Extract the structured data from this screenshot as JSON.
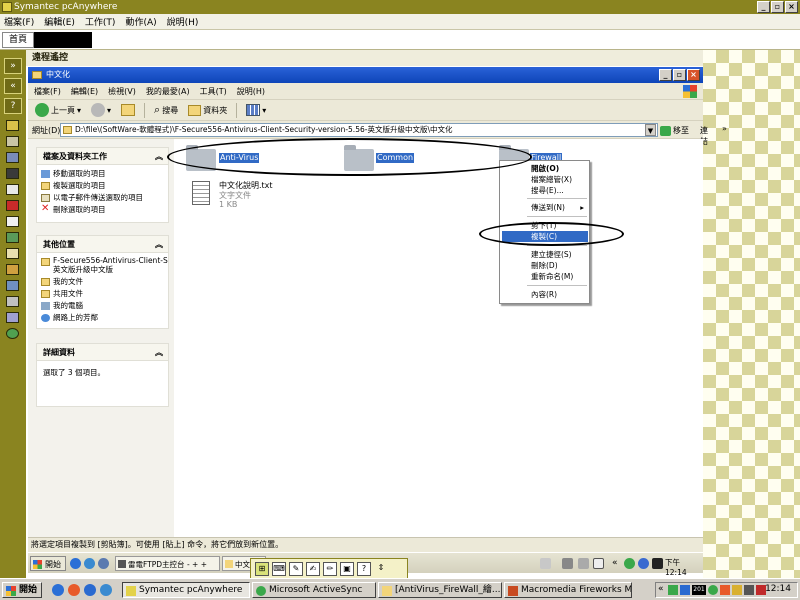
{
  "outer_window": {
    "title": "Symantec pcAnywhere",
    "menu": [
      "檔案(F)",
      "編輯(E)",
      "工作(T)",
      "動作(A)",
      "說明(H)"
    ],
    "tab": "首頁",
    "session_title": "遠程遙控"
  },
  "explorer": {
    "title": "中文化",
    "menu": [
      "檔案(F)",
      "編輯(E)",
      "檢視(V)",
      "我的最愛(A)",
      "工具(T)",
      "說明(H)"
    ],
    "toolbar": {
      "back": "上一頁",
      "search": "搜尋",
      "folders": "資料夾"
    },
    "address_label": "網址(D)",
    "address": "D:\\file\\(SoftWare-軟體程式)\\F-Secure556-Antivirus-Client-Security-version-5.56-英文版升級中文版\\中文化",
    "go": "移至",
    "links": "連結"
  },
  "task_pane": {
    "file_tasks": {
      "title": "檔案及資料夾工作",
      "items": [
        "移動選取的項目",
        "複製選取的項目",
        "以電子郵件傳送選取的項目",
        "刪除選取的項目"
      ]
    },
    "other_places": {
      "title": "其他位置",
      "items": [
        "F-Secure556-Antivirus-Client-S 英文版升級中文版",
        "我的文件",
        "共用文件",
        "我的電腦",
        "網路上的芳鄰"
      ]
    },
    "details": {
      "title": "詳細資料",
      "text": "選取了 3 個項目。"
    }
  },
  "files": [
    {
      "name": "Anti-Virus",
      "selected": true
    },
    {
      "name": "Common",
      "selected": true
    },
    {
      "name": "Firewall",
      "selected": true
    },
    {
      "name": "中文化說明.txt",
      "type": "文字文件",
      "size": "1 KB",
      "selected": false
    }
  ],
  "context_menu": {
    "items": [
      {
        "label": "開啟(O)",
        "bold": true
      },
      {
        "label": "檔案總管(X)"
      },
      {
        "label": "搜尋(E)..."
      },
      {
        "label": "傳送到(N)",
        "submenu": true
      },
      {
        "label": "剪下(T)"
      },
      {
        "label": "複製(C)",
        "highlighted": true
      },
      {
        "label": "建立捷徑(S)"
      },
      {
        "label": "刪除(D)"
      },
      {
        "label": "重新命名(M)"
      },
      {
        "label": "內容(R)"
      }
    ]
  },
  "status_bar": "將選定項目複製到 [剪貼簿]。可使用 [貼上] 命令，將它們放到新位置。",
  "remote_taskbar": {
    "start": "開始",
    "tasks": [
      "雷電FTPD主控台 - + +",
      "中文化"
    ],
    "clock": "下午 12:14"
  },
  "host_taskbar": {
    "start": "開始",
    "tasks": [
      "Symantec pcAnywhere",
      "Microsoft ActiveSync",
      "[AntiVirus_FireWall_繪...",
      "Macromedia Fireworks M..."
    ],
    "clock": "12:14",
    "tray_badge": "201"
  },
  "colors": {
    "outer_chrome": "#8a8420",
    "xp_blue": "#0e45b8",
    "selection": "#316ac5"
  }
}
